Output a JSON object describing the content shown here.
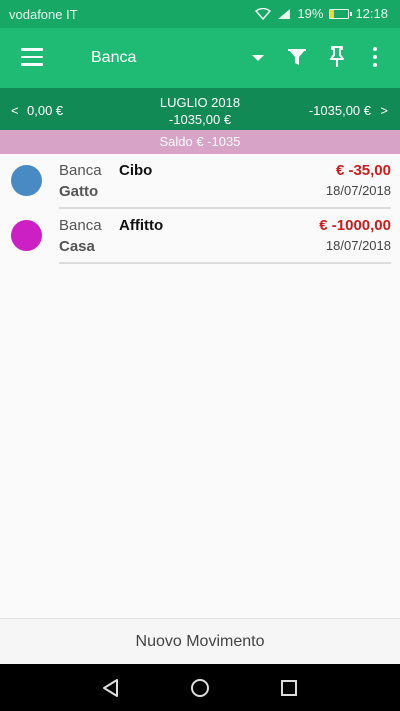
{
  "status": {
    "carrier": "vodafone IT",
    "battery": "19%",
    "time": "12:18"
  },
  "appbar": {
    "title": "Banca"
  },
  "month": {
    "prev_arrow": "<",
    "prev_amount": "0,00 €",
    "label": "LUGLIO 2018",
    "total": "-1035,00 €",
    "next_amount": "-1035,00 €",
    "next_arrow": ">"
  },
  "saldo": "Saldo € -1035",
  "transactions": [
    {
      "account": "Banca",
      "description": "Cibo",
      "category": "Gatto",
      "amount": "€ -35,00",
      "date": "18/07/2018",
      "color": "#4a8ac4"
    },
    {
      "account": "Banca",
      "description": "Affitto",
      "category": "Casa",
      "amount": "€ -1000,00",
      "date": "18/07/2018",
      "color": "#cc1fc4"
    }
  ],
  "new_button": "Nuovo Movimento",
  "colors": {
    "statusbar": "#17a865",
    "appbar": "#1fba73",
    "monthbar": "#128a55",
    "saldo": "#d7a3c6",
    "amount_negative": "#d01a1a"
  }
}
